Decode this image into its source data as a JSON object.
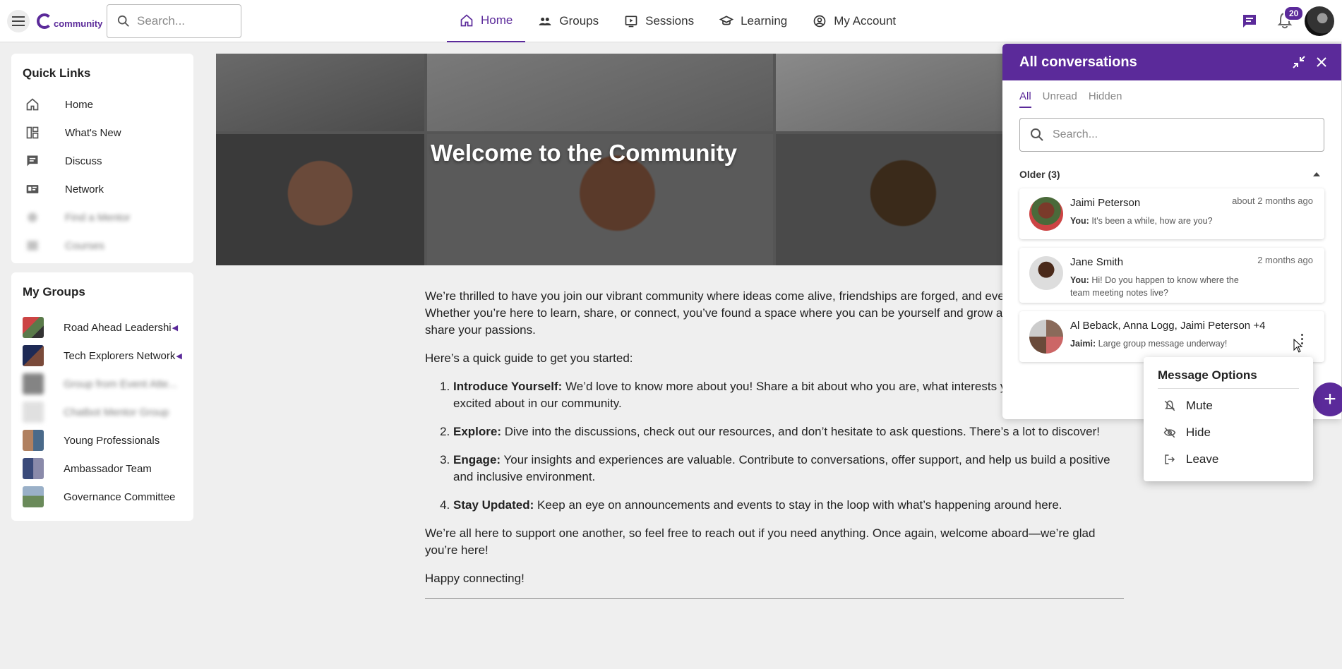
{
  "header": {
    "logo_text": "community",
    "search_placeholder": "Search...",
    "nav": [
      {
        "label": "Home",
        "icon": "home-icon",
        "active": true
      },
      {
        "label": "Groups",
        "icon": "groups-icon",
        "active": false
      },
      {
        "label": "Sessions",
        "icon": "sessions-icon",
        "active": false
      },
      {
        "label": "Learning",
        "icon": "learning-icon",
        "active": false
      },
      {
        "label": "My Account",
        "icon": "account-icon",
        "active": false
      }
    ],
    "notification_count": "20"
  },
  "quick_links": {
    "title": "Quick Links",
    "items": [
      {
        "label": "Home",
        "icon": "home-icon"
      },
      {
        "label": "What's New",
        "icon": "dashboard-icon"
      },
      {
        "label": "Discuss",
        "icon": "discuss-icon"
      },
      {
        "label": "Network",
        "icon": "network-icon"
      },
      {
        "label": "Find a Mentor",
        "icon": "mentor-icon"
      },
      {
        "label": "Courses",
        "icon": "courses-icon"
      }
    ]
  },
  "my_groups": {
    "title": "My Groups",
    "items": [
      {
        "label": "Road Ahead Leadershi",
        "color": "#a33a3a"
      },
      {
        "label": "Tech Explorers Network",
        "color": "#2e3d6b"
      },
      {
        "label": "Group from Event Atte...",
        "color": "#333333"
      },
      {
        "label": "Chatbot Mentor Group",
        "color": "#cccccc"
      },
      {
        "label": "Young Professionals",
        "color": "#8a6a4a"
      },
      {
        "label": "Ambassador Team",
        "color": "#4a5a8a"
      },
      {
        "label": "Governance Committee",
        "color": "#6a8a5a"
      }
    ]
  },
  "banner": {
    "title": "Welcome to the Community"
  },
  "article": {
    "intro": "We’re thrilled to have you join our vibrant community where ideas come alive, friendships are forged, and every voice matters. Whether you’re here to learn, share, or connect, you’ve found a space where you can be yourself and grow alongside others who share your passions.",
    "guide_intro": "Here’s a quick guide to get you started:",
    "steps": [
      {
        "title": "Introduce Yourself:",
        "text": " We’d love to know more about you! Share a bit about who you are, what interests you, and what you’re excited about in our community."
      },
      {
        "title": "Explore:",
        "text": " Dive into the discussions, check out our resources, and don’t hesitate to ask questions. There’s a lot to discover!"
      },
      {
        "title": "Engage:",
        "text": " Your insights and experiences are valuable. Contribute to conversations, offer support, and help us build a positive and inclusive environment."
      },
      {
        "title": "Stay Updated:",
        "text": " Keep an eye on announcements and events to stay in the loop with what’s happening around here."
      }
    ],
    "closing": "We’re all here to support one another, so feel free to reach out if you need anything. Once again, welcome aboard—we’re glad you’re here!",
    "signoff": "Happy connecting!"
  },
  "conversations": {
    "title": "All conversations",
    "tabs": [
      {
        "label": "All",
        "active": true
      },
      {
        "label": "Unread",
        "active": false
      },
      {
        "label": "Hidden",
        "active": false
      }
    ],
    "search_placeholder": "Search...",
    "section_label": "Older (3)",
    "items": [
      {
        "name": "Jaimi Peterson",
        "time": "about 2 months ago",
        "sender": "You:",
        "message": " It's been a while, how are you?",
        "color": "#7a3a2a"
      },
      {
        "name": "Jane Smith",
        "time": "2 months ago",
        "sender": "You:",
        "message": " Hi! Do you happen to know where the team meeting notes live?",
        "color": "#4a2a1a"
      },
      {
        "name": "Al Beback, Anna Logg, Jaimi Peterson +4",
        "time": "",
        "sender": "Jaimi:",
        "message": " Large group message underway!",
        "color": "#8a6a5a"
      }
    ]
  },
  "message_options": {
    "title": "Message Options",
    "items": [
      {
        "label": "Mute",
        "icon": "mute-icon"
      },
      {
        "label": "Hide",
        "icon": "hide-icon"
      },
      {
        "label": "Leave",
        "icon": "leave-icon"
      }
    ]
  },
  "colors": {
    "brand": "#5b2a9a",
    "background": "#efefef"
  }
}
